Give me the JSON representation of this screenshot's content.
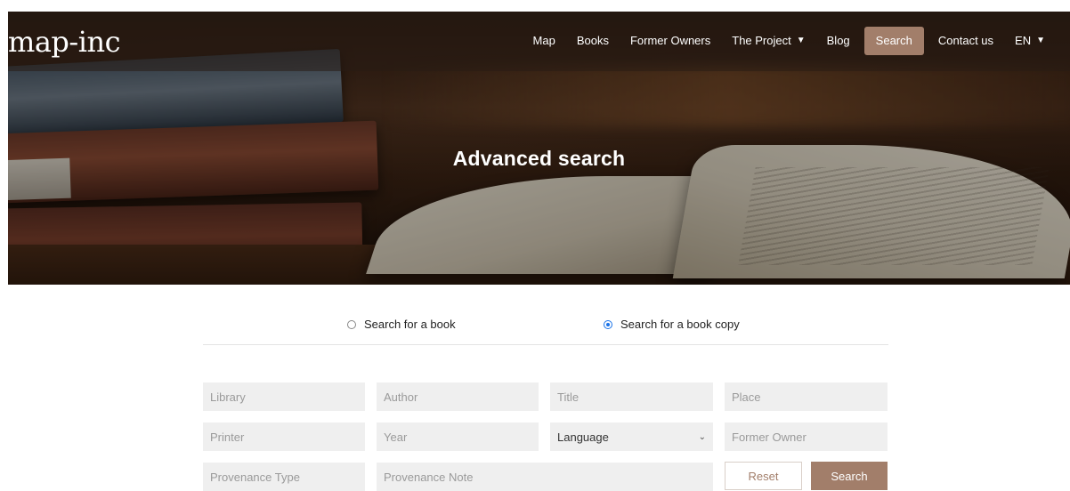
{
  "header": {
    "logo": "map-inc",
    "nav": [
      {
        "label": "Map"
      },
      {
        "label": "Books"
      },
      {
        "label": "Former Owners"
      },
      {
        "label": "The Project",
        "caret": "▼"
      },
      {
        "label": "Blog"
      },
      {
        "label": "Search",
        "active": true
      },
      {
        "label": "Contact us"
      },
      {
        "label": "EN",
        "caret": "▼"
      }
    ]
  },
  "hero": {
    "title": "Advanced search"
  },
  "search_mode": {
    "options": [
      {
        "label": "Search for a book",
        "checked": false
      },
      {
        "label": "Search for a book copy",
        "checked": true
      }
    ]
  },
  "fields": {
    "library": "Library",
    "author": "Author",
    "title": "Title",
    "place": "Place",
    "printer": "Printer",
    "year": "Year",
    "language": "Language",
    "former_owner": "Former Owner",
    "provenance_type": "Provenance Type",
    "provenance_note": "Provenance Note"
  },
  "buttons": {
    "reset": "Reset",
    "search": "Search"
  },
  "colors": {
    "accent": "#a27e6a",
    "field_bg": "#efefef",
    "radio_checked": "#1a73e8"
  },
  "icons": {
    "dropdown": "chevron-down-icon",
    "nav_caret": "caret-down-icon"
  }
}
